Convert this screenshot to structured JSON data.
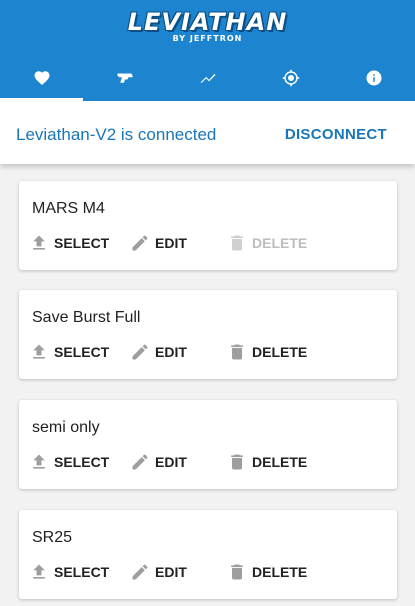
{
  "header": {
    "logo_main": "LEVIATHAN",
    "logo_sub": "BY JEFFTRON",
    "tabs": [
      {
        "icon": "heart-icon",
        "active": true
      },
      {
        "icon": "gun-icon",
        "active": false
      },
      {
        "icon": "trending-icon",
        "active": false
      },
      {
        "icon": "crosshair-icon",
        "active": false
      },
      {
        "icon": "info-icon",
        "active": false
      }
    ]
  },
  "connection": {
    "status": "Leviathan-V2 is connected",
    "button": "DISCONNECT"
  },
  "profiles": [
    {
      "name": "MARS M4",
      "select": "SELECT",
      "edit": "EDIT",
      "delete": "DELETE",
      "delete_enabled": false
    },
    {
      "name": "Save Burst Full",
      "select": "SELECT",
      "edit": "EDIT",
      "delete": "DELETE",
      "delete_enabled": true
    },
    {
      "name": "semi only",
      "select": "SELECT",
      "edit": "EDIT",
      "delete": "DELETE",
      "delete_enabled": true
    },
    {
      "name": "SR25",
      "select": "SELECT",
      "edit": "EDIT",
      "delete": "DELETE",
      "delete_enabled": true
    }
  ],
  "colors": {
    "primary": "#1d85cf",
    "accent_text": "#1976b8",
    "background": "#f2f2f2"
  }
}
